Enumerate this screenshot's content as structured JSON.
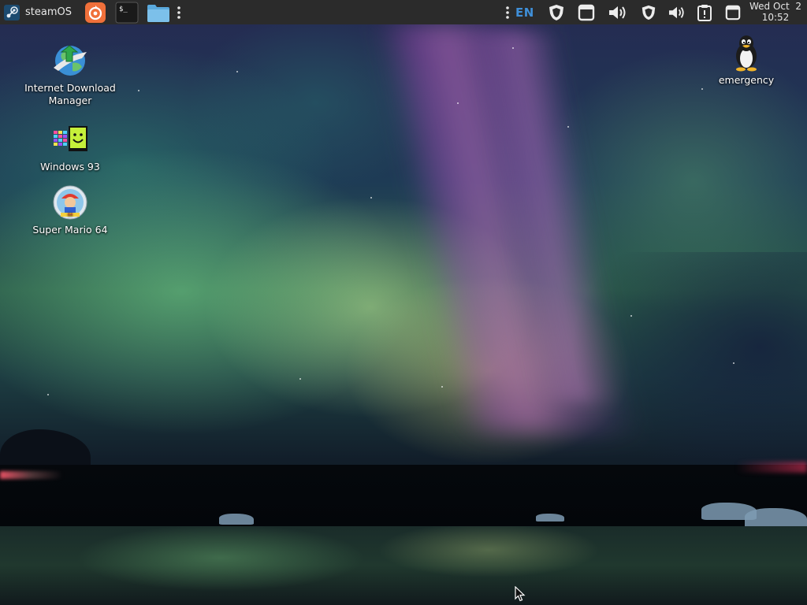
{
  "top_panel": {
    "brand": {
      "label": "steamOS",
      "icon": "steam-icon"
    },
    "launchers": [
      {
        "name": "app-launcher",
        "icon": "orange-app-icon"
      },
      {
        "name": "terminal",
        "icon": "terminal-icon"
      },
      {
        "name": "files",
        "icon": "folder-icon"
      }
    ],
    "keyboard_layout": "EN",
    "tray_icons": [
      "overflow-menu-icon",
      "shield-icon",
      "window-icon",
      "volume-icon",
      "shield-icon",
      "volume-icon",
      "clipboard-icon",
      "window-icon"
    ],
    "clock": {
      "date": "Wed Oct  2",
      "time": "10:52"
    }
  },
  "desktop_icons": [
    {
      "label": "Internet Download Manager",
      "icon": "idm-globe-icon"
    },
    {
      "label": "Windows 93",
      "icon": "windows93-icon"
    },
    {
      "label": "Super Mario 64",
      "icon": "mario64-icon"
    },
    {
      "label": "emergency",
      "icon": "tux-penguin-icon"
    }
  ],
  "colors": {
    "panel_bg": "#2b2b2b",
    "panel_text": "#e8e8e8",
    "en_accent": "#3f8fd8",
    "launcher_orange": "#f0703a",
    "folder_blue": "#5aa9dd"
  }
}
